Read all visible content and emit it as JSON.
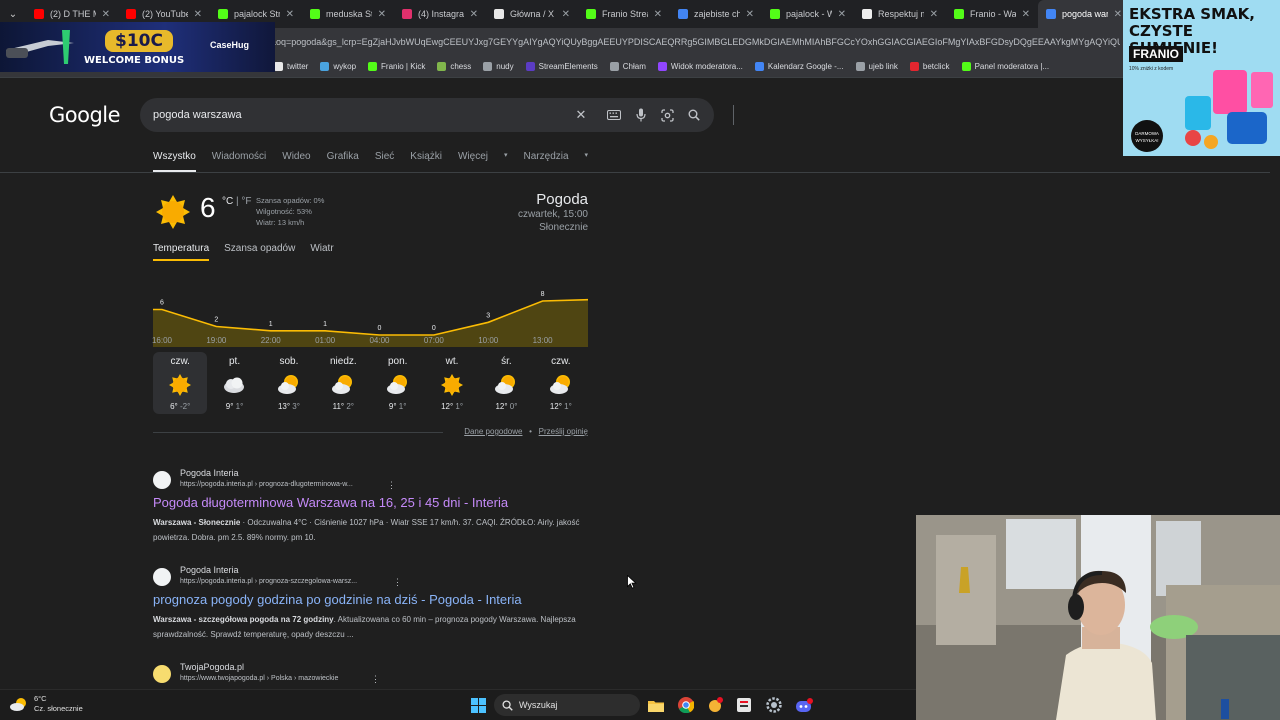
{
  "browser": {
    "tabs": [
      {
        "label": "(2) D THE M",
        "fav_color": "#ff0000",
        "active": false
      },
      {
        "label": "(2) YouTube",
        "fav_color": "#ff0000",
        "active": false
      },
      {
        "label": "pajalock Stre",
        "fav_color": "#53fc18",
        "active": false
      },
      {
        "label": "meduska Stre",
        "fav_color": "#53fc18",
        "active": false
      },
      {
        "label": "(4) Instagram",
        "fav_color": "#e1306c",
        "active": false
      },
      {
        "label": "Główna / X",
        "fav_color": "#e8e8e8",
        "active": false
      },
      {
        "label": "Franio Stream",
        "fav_color": "#53fc18",
        "active": false
      },
      {
        "label": "zajebiste chi",
        "fav_color": "#4285f4",
        "active": false
      },
      {
        "label": "pajalock - W",
        "fav_color": "#53fc18",
        "active": false
      },
      {
        "label": "Respektuj m",
        "fav_color": "#eeeeee",
        "active": false
      },
      {
        "label": "Franio - Wat",
        "fav_color": "#53fc18",
        "active": false
      },
      {
        "label": "pogoda war",
        "fav_color": "#4285f4",
        "active": true
      }
    ],
    "url": "&oq=pogoda&gs_lcrp=EgZjaHJvbWUqEwgCEEUYJxg7GEYYgAIYgAQYiQUyBggAEEUYPDISCAEQRRg5GIMBGLEDGMkDGIAEMhMIAhBFGCcYOxhGGIACGIAEGIoFMgYIAxBFGDsyDQgEEAAYkgMYgAQYiQUy...",
    "bookmarks": [
      {
        "label": "twitter",
        "color": "#e8e8e8"
      },
      {
        "label": "wykop",
        "color": "#4aa3df"
      },
      {
        "label": "Franio | Kick",
        "color": "#53fc18"
      },
      {
        "label": "chess",
        "color": "#81b64c"
      },
      {
        "label": "nudy",
        "color": "#9aa0a6"
      },
      {
        "label": "StreamElements",
        "color": "#5b3cc4"
      },
      {
        "label": "Chłam",
        "color": "#9aa0a6"
      },
      {
        "label": "Widok moderatora...",
        "color": "#9146ff"
      },
      {
        "label": "Kalendarz Google -...",
        "color": "#4285f4"
      },
      {
        "label": "ujeb link",
        "color": "#9aa0a6"
      },
      {
        "label": "betclick",
        "color": "#e3262f"
      },
      {
        "label": "Panel moderatora |...",
        "color": "#53fc18"
      }
    ]
  },
  "ads": {
    "casehug": {
      "money": "$10C",
      "welcome": "WELCOME BONUS",
      "brand": "CaseHug"
    },
    "franio": {
      "headline_1": "EKSTRA SMAK,",
      "headline_2": "CZYSTE SUMIENIE!",
      "brand": "FRANIO",
      "promo": "10% zniżki z kodem",
      "badge": "DARMOWA WYSYŁKA!"
    }
  },
  "google": {
    "logo": "Google",
    "query": "pogoda warszawa",
    "nav": [
      "Wszystko",
      "Wiadomości",
      "Wideo",
      "Grafika",
      "Sieć",
      "Książki",
      "Więcej",
      "Narzędzia"
    ],
    "weather": {
      "temp": "6",
      "unit_c": "°C",
      "unit_sep": " | ",
      "unit_f": "°F",
      "precip": "Szansa opadów: 0%",
      "humidity": "Wilgotność: 53%",
      "wind": "Wiatr: 13 km/h",
      "title": "Pogoda",
      "day_time": "czwartek, 15:00",
      "condition": "Słonecznie",
      "tabs": [
        "Temperatura",
        "Szansa opadów",
        "Wiatr"
      ],
      "chart_hours": [
        "16:00",
        "19:00",
        "22:00",
        "01:00",
        "04:00",
        "07:00",
        "10:00",
        "13:00"
      ],
      "chart_values": [
        6,
        2,
        1,
        1,
        0,
        0,
        3,
        8
      ],
      "forecast": [
        {
          "day": "czw.",
          "hi": "6°",
          "lo": "-2°",
          "icon": "sun-icon"
        },
        {
          "day": "pt.",
          "hi": "9°",
          "lo": "1°",
          "icon": "cloud-icon"
        },
        {
          "day": "sob.",
          "hi": "13°",
          "lo": "3°",
          "icon": "partly-cloudy-icon"
        },
        {
          "day": "niedz.",
          "hi": "11°",
          "lo": "2°",
          "icon": "partly-cloudy-icon"
        },
        {
          "day": "pon.",
          "hi": "9°",
          "lo": "1°",
          "icon": "partly-cloudy-icon"
        },
        {
          "day": "wt.",
          "hi": "12°",
          "lo": "1°",
          "icon": "sun-icon"
        },
        {
          "day": "śr.",
          "hi": "12°",
          "lo": "0°",
          "icon": "partly-cloudy-icon"
        },
        {
          "day": "czw.",
          "hi": "12°",
          "lo": "1°",
          "icon": "partly-cloudy-icon"
        }
      ],
      "footer_data": "Dane pogodowe",
      "footer_sep": "•",
      "footer_feedback": "Prześlij opinię"
    },
    "results": [
      {
        "site": "Pogoda Interia",
        "url": "https://pogoda.interia.pl › prognoza-dlugoterminowa-w...",
        "title": "Pogoda długoterminowa Warszawa na 16, 25 i 45 dni - Interia",
        "title_color": "#c58af9",
        "snippet_bold": "Warszawa - Słonecznie",
        "snippet": " · Odczuwalna 4°C · Ciśnienie 1027 hPa · Wiatr SSE 17 km/h. 37. CAQI. ŹRÓDŁO: Airly. jakość powietrza. Dobra. pm 2.5. 89% normy. pm 10."
      },
      {
        "site": "Pogoda Interia",
        "url": "https://pogoda.interia.pl › prognoza-szczegolowa-warsz...",
        "title": "prognoza pogody godzina po godzinie na dziś - Pogoda - Interia",
        "title_color": "#8ab4f8",
        "snippet_bold": "Warszawa - szczegółowa pogoda na 72 godziny",
        "snippet": ". Aktualizowana co 60 min – prognoza pogody Warszawa. Najlepsza sprawdzalność. Sprawdź temperaturę, opady deszczu ..."
      },
      {
        "site": "TwojaPogoda.pl",
        "url": "https://www.twojapogoda.pl › Polska › mazowieckie",
        "title": "",
        "title_color": "#8ab4f8",
        "snippet_bold": "",
        "snippet": ""
      }
    ]
  },
  "taskbar": {
    "weather_temp": "6°C",
    "weather_desc": "Cz. słonecznie",
    "search_placeholder": "Wyszukaj"
  }
}
